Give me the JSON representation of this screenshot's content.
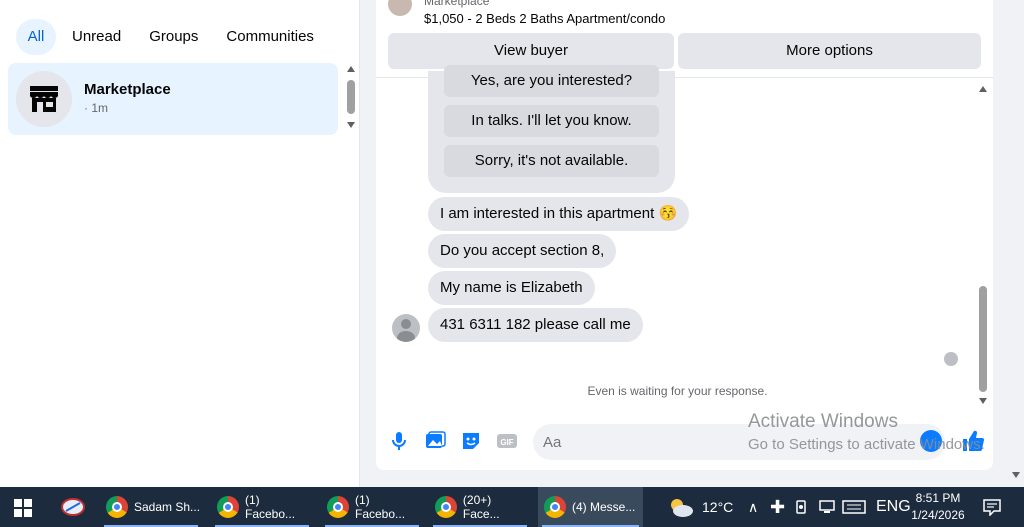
{
  "left_pane": {
    "filters": [
      "All",
      "Unread",
      "Groups",
      "Communities"
    ],
    "active_filter": "All",
    "conversation": {
      "name": "Marketplace",
      "time": "· 1m"
    }
  },
  "chat": {
    "listing": {
      "source": "Marketplace",
      "title": "$1,050 - 2 Beds 2 Baths Apartment/condo",
      "buttons": {
        "view_buyer": "View buyer",
        "more_options": "More options"
      }
    },
    "quick_replies": [
      "Yes, are you interested?",
      "In talks. I'll let you know.",
      "Sorry, it's not available."
    ],
    "messages": [
      "I am interested in this apartment 😚",
      "Do you accept section 8,",
      "My name is Elizabeth",
      "431 6311 182 please call me"
    ],
    "waiting_text": "Even is waiting for your response.",
    "composer": {
      "placeholder": "Aa"
    }
  },
  "watermark": {
    "line1": "Activate Windows",
    "line2": "Go to Settings to activate Windows."
  },
  "taskbar": {
    "apps": [
      {
        "label": "Sadam Sh...",
        "active": false
      },
      {
        "label": "(1) Facebo...",
        "active": false
      },
      {
        "label": "(1) Facebo...",
        "active": false
      },
      {
        "label": "(20+) Face...",
        "active": false
      },
      {
        "label": "(4) Messe...",
        "active": true
      }
    ],
    "weather": "12°C",
    "language": "ENG",
    "time": "8:51 PM",
    "date": "1/24/2026"
  },
  "colors": {
    "accent": "#0a7cff",
    "selected_bg": "#e7f3ff",
    "taskbar": "#1c2b3d"
  }
}
